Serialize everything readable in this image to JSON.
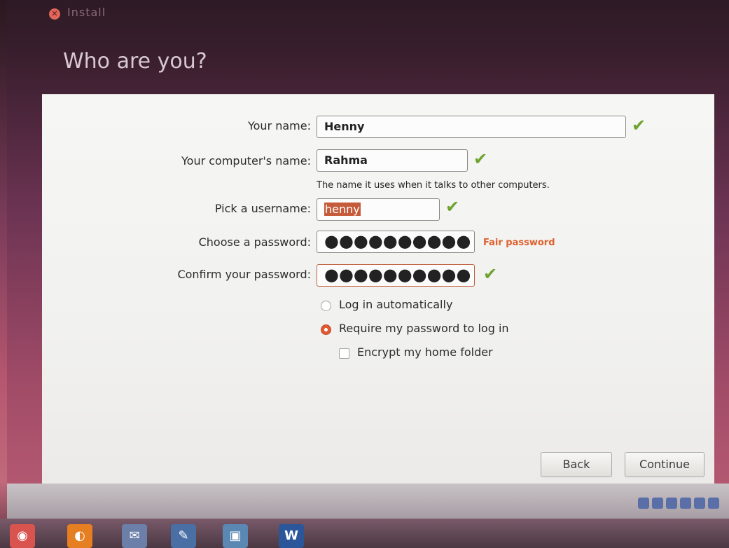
{
  "window": {
    "title": "Install",
    "heading": "Who are you?"
  },
  "form": {
    "your_name": {
      "label": "Your name:",
      "value": "Henny"
    },
    "computer_name": {
      "label": "Your computer's name:",
      "value": "Rahma",
      "hint": "The name it uses when it talks to other computers."
    },
    "username": {
      "label": "Pick a username:",
      "value": "henny"
    },
    "password": {
      "label": "Choose a password:",
      "value": "●●●●●●●●●●",
      "strength": "Fair password"
    },
    "confirm_password": {
      "label": "Confirm your password:",
      "value": "●●●●●●●●●●"
    }
  },
  "options": {
    "login_auto": {
      "label": "Log in automatically",
      "checked": false
    },
    "require_password": {
      "label": "Require my password to log in",
      "checked": true
    },
    "encrypt_home": {
      "label": "Encrypt my home folder",
      "checked": false
    }
  },
  "buttons": {
    "back": "Back",
    "continue": "Continue"
  },
  "icons": {
    "valid": "check-icon",
    "close": "close-icon"
  },
  "colors": {
    "accent": "#e05a33",
    "valid_check": "#6ea32f",
    "password_strength": "#e0612d"
  }
}
